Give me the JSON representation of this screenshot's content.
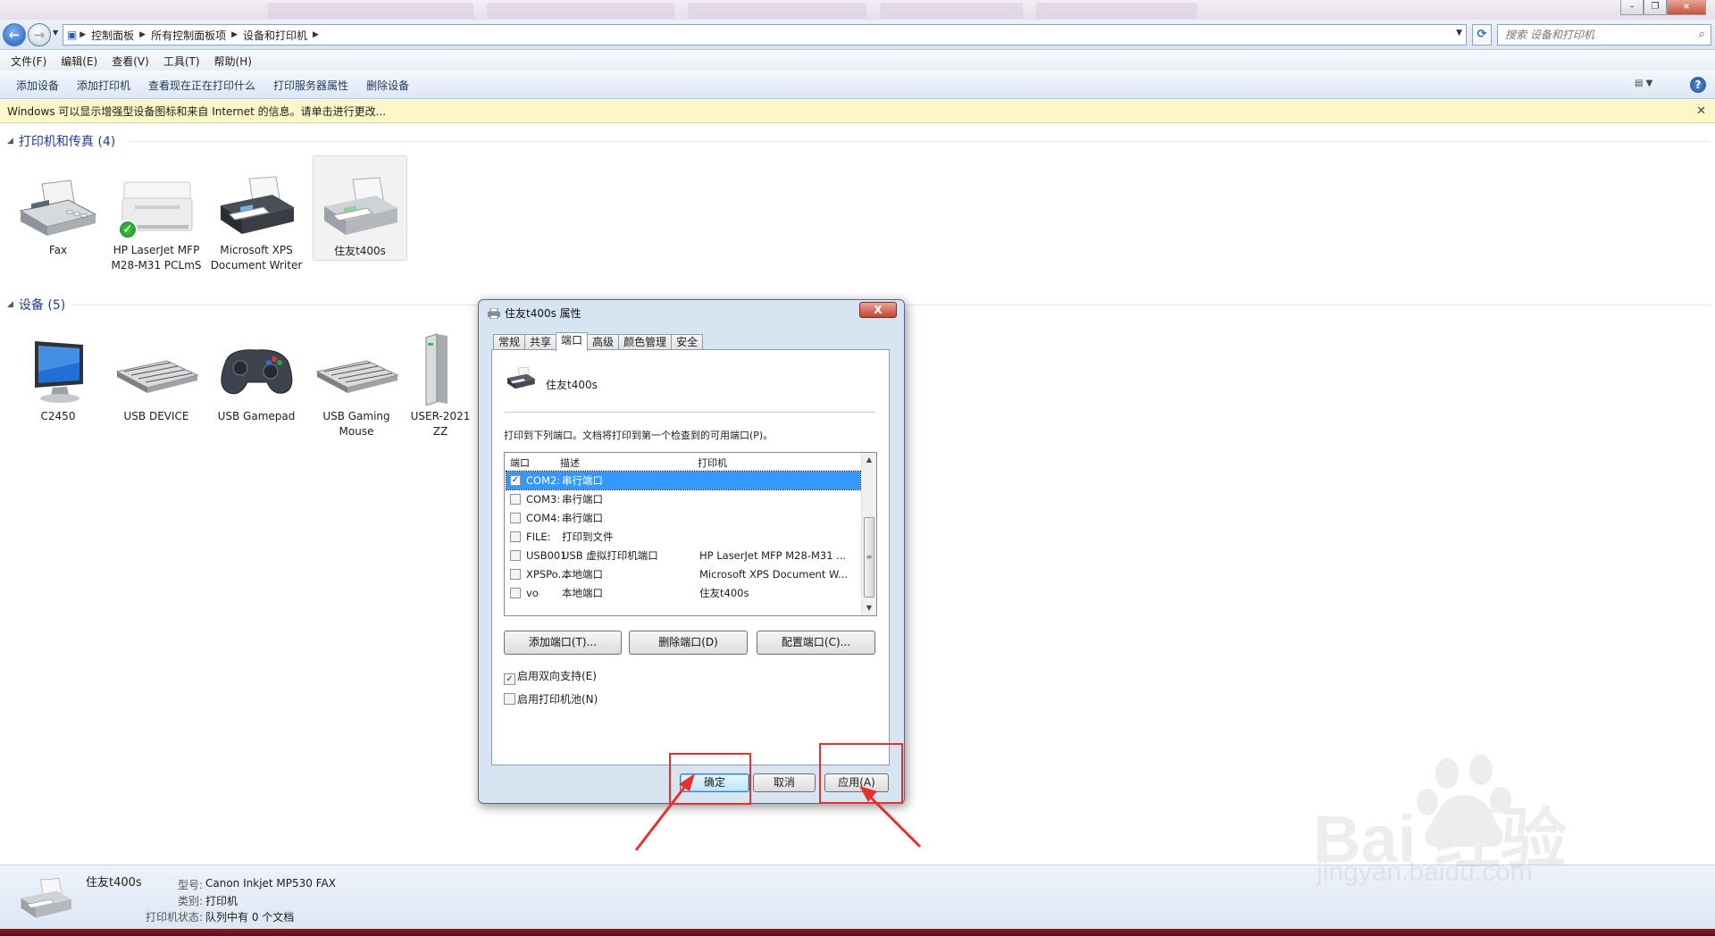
{
  "window": {
    "controls": [
      "minimize",
      "restore",
      "close"
    ]
  },
  "address": {
    "crumbs": [
      "控制面板",
      "所有控制面板项",
      "设备和打印机"
    ]
  },
  "search": {
    "placeholder": "搜索 设备和打印机"
  },
  "menubar": {
    "items": [
      "文件(F)",
      "编辑(E)",
      "查看(V)",
      "工具(T)",
      "帮助(H)"
    ]
  },
  "commandbar": {
    "items": [
      "添加设备",
      "添加打印机",
      "查看现在正在打印什么",
      "打印服务器属性",
      "删除设备"
    ]
  },
  "infobar": {
    "text": "Windows 可以显示增强型设备图标和来自 Internet 的信息。请单击进行更改..."
  },
  "groups": {
    "printers": {
      "header": "打印机和传真 (4)",
      "items": [
        {
          "label": "Fax",
          "icon": "fax-icon"
        },
        {
          "label": "HP LaserJet MFP M28-M31 PCLmS",
          "icon": "laser-printer-icon",
          "default": true
        },
        {
          "label": "Microsoft XPS Document Writer",
          "icon": "inkjet-printer-icon"
        },
        {
          "label": "住友t400s",
          "icon": "printer-icon",
          "selected": true
        }
      ]
    },
    "devices": {
      "header": "设备 (5)",
      "items": [
        {
          "label": "C2450",
          "icon": "monitor-icon"
        },
        {
          "label": "USB DEVICE",
          "icon": "keyboard-icon"
        },
        {
          "label": "USB Gamepad",
          "icon": "gamepad-icon"
        },
        {
          "label": "USB Gaming Mouse",
          "icon": "keyboard-icon"
        },
        {
          "label": "USER-2021 ZZ",
          "icon": "computer-tower-icon"
        }
      ]
    }
  },
  "details": {
    "name": "住友t400s",
    "model_label": "型号:",
    "model_value": "Canon Inkjet MP530 FAX",
    "category_label": "类别:",
    "category_value": "打印机",
    "status_label": "打印机状态:",
    "status_value": "队列中有 0 个文档"
  },
  "dialog": {
    "title": "住友t400s 属性",
    "close_label": "X",
    "tabs": [
      "常规",
      "共享",
      "端口",
      "高级",
      "颜色管理",
      "安全"
    ],
    "active_tab": "端口",
    "printer_name": "住友t400s",
    "instruction": "打印到下列端口。文档将打印到第一个检查到的可用端口(P)。",
    "port_columns": [
      "端口",
      "描述",
      "打印机"
    ],
    "ports": [
      {
        "port": "COM2:",
        "desc": "串行端口",
        "printer": "",
        "checked": true,
        "selected": true
      },
      {
        "port": "COM3:",
        "desc": "串行端口",
        "printer": "",
        "checked": false
      },
      {
        "port": "COM4:",
        "desc": "串行端口",
        "printer": "",
        "checked": false
      },
      {
        "port": "FILE:",
        "desc": "打印到文件",
        "printer": "",
        "checked": false
      },
      {
        "port": "USB001",
        "desc": "USB 虚拟打印机端口",
        "printer": "HP LaserJet MFP M28-M31 ...",
        "checked": false
      },
      {
        "port": "XPSPo...",
        "desc": "本地端口",
        "printer": "Microsoft XPS Document W...",
        "checked": false
      },
      {
        "port": "vo",
        "desc": "本地端口",
        "printer": "住友t400s",
        "checked": false
      }
    ],
    "buttons": {
      "add_port": "添加端口(T)...",
      "delete_port": "删除端口(D)",
      "configure_port": "配置端口(C)..."
    },
    "options": {
      "bidirectional": {
        "label": "启用双向支持(E)",
        "checked": true
      },
      "pooling": {
        "label": "启用打印机池(N)",
        "checked": false
      }
    },
    "footer": {
      "ok": "确定",
      "cancel": "取消",
      "apply": "应用(A)"
    }
  },
  "watermark": {
    "brand": "Bai 经验",
    "url": "jingyan.baidu.com"
  },
  "colors": {
    "accent": "#1e3d8c",
    "highlight": "#3399ff",
    "annotation": "#e8312c",
    "infobar": "#fcf7c8"
  }
}
